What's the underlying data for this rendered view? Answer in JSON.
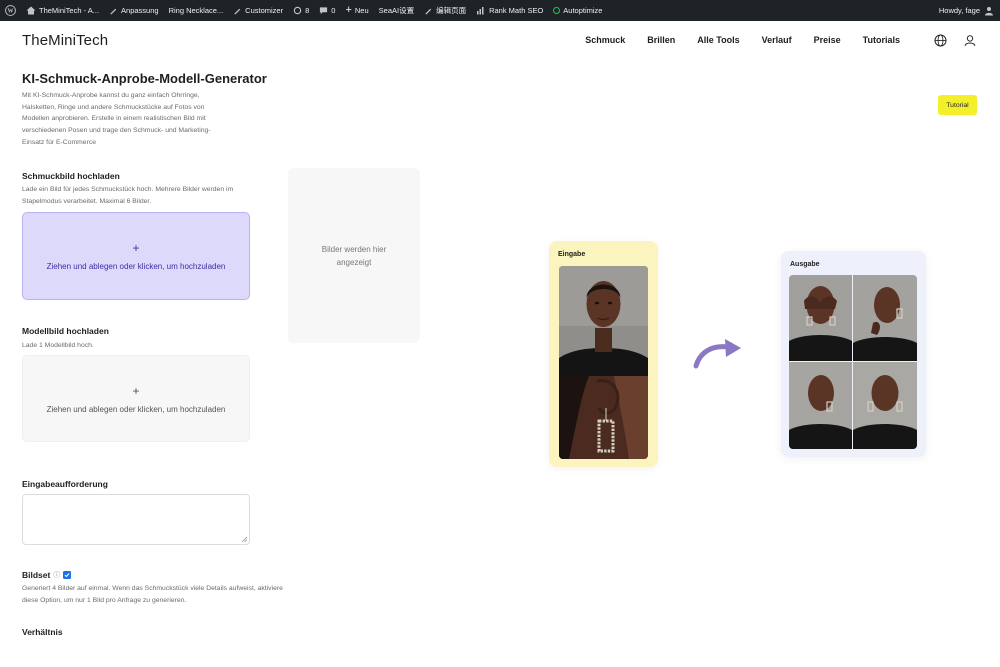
{
  "adminbar": {
    "site": "TheMiniTech - A...",
    "customize": "Anpassung",
    "edit": "Ring Necklace...",
    "customizer": "Customizer",
    "updates": "8",
    "comments": "0",
    "new": "Neu",
    "seaai": "SeaAI设置",
    "edit_page": "编辑页面",
    "rankmath": "Rank Math SEO",
    "autoptimize": "Autoptimize",
    "howdy": "Howdy, fage"
  },
  "header": {
    "logo": "TheMiniTech",
    "nav": [
      "Schmuck",
      "Brillen",
      "Alle Tools",
      "Verlauf",
      "Preise",
      "Tutorials"
    ]
  },
  "main": {
    "title": "KI-Schmuck-Anprobe-Modell-Generator",
    "description": "Mit KI-Schmuck-Anprobe kannst du ganz einfach Ohrringe, Halsketten, Ringe und andere Schmuckstücke auf Fotos von Modellen anprobieren. Erstelle in einem realistischen Bild mit verschiedenen Posen und trage den Schmuck- und Marketing-Einsatz für E-Commerce",
    "tutorial": "Tutorial"
  },
  "jewelry_upload": {
    "title": "Schmuckbild hochladen",
    "description": "Lade ein Bild für jedes Schmuckstück hoch. Mehrere Bilder werden im Stapelmodus verarbeitet. Maximal 6 Bilder.",
    "plus": "+",
    "cta": "Ziehen und ablegen oder klicken, um hochzuladen"
  },
  "model_upload": {
    "title": "Modellbild hochladen",
    "description": "Lade 1 Modellbild hoch.",
    "plus": "+",
    "cta": "Ziehen und ablegen oder klicken, um hochzuladen"
  },
  "prompt": {
    "title": "Eingabeaufforderung",
    "value": ""
  },
  "bildset": {
    "label": "Bildset",
    "info": "ⓘ",
    "checked": true,
    "description": "Generiert 4 Bilder auf einmal. Wenn das Schmuckstück viele Details aufweist, aktiviere diese Option, um nur 1 Bild pro Anfrage zu generieren."
  },
  "ratio": {
    "title": "Verhältnis"
  },
  "preview": {
    "placeholder": "Bilder werden hier angezeigt"
  },
  "example": {
    "input_label": "Eingabe",
    "output_label": "Ausgabe",
    "arrow_color": "#8a78c4"
  },
  "colors": {
    "primary_dropzone": "#dcd9fb",
    "primary_text": "#3b2fa8",
    "tutorial_bg": "#f3f02a",
    "input_card": "#fbf4be",
    "output_card": "#eef0fb",
    "adminbar_bg": "#1d2327"
  }
}
